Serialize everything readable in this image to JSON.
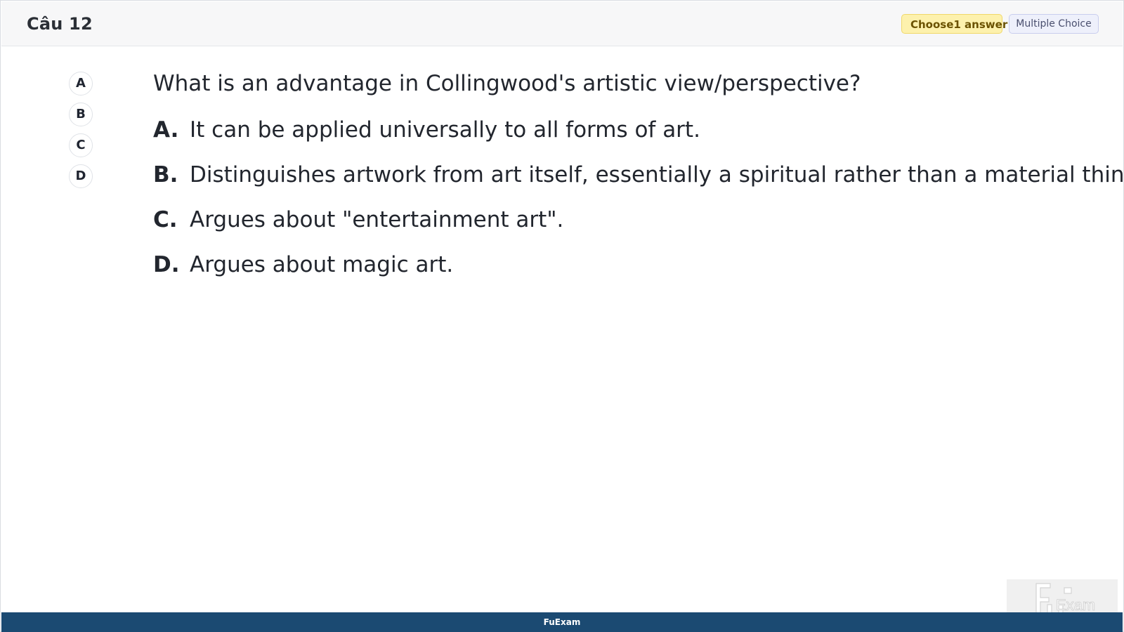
{
  "header": {
    "question_label": "Câu 12",
    "choose_badge": "Choose1 answer",
    "type_badge": "Multiple Choice"
  },
  "answer_nav": {
    "buttons": [
      "A",
      "B",
      "C",
      "D"
    ]
  },
  "question": {
    "text": "What is an advantage in Collingwood's artistic view/perspective?"
  },
  "options": [
    {
      "letter": "A.",
      "text": "It can be applied universally to all forms of art."
    },
    {
      "letter": "B.",
      "text": "Distinguishes artwork from art itself, essentially a spiritual rather than a material thing."
    },
    {
      "letter": "C.",
      "text": "Argues about \"entertainment art\"."
    },
    {
      "letter": "D.",
      "text": "Argues about magic art."
    }
  ],
  "footer": {
    "brand": "FuExam"
  },
  "logo": {
    "text": "FU Exam"
  },
  "colors": {
    "footer_bg": "#1b4a72",
    "choose_badge_bg": "#fdf1ad",
    "type_badge_bg": "#eef0fb"
  }
}
